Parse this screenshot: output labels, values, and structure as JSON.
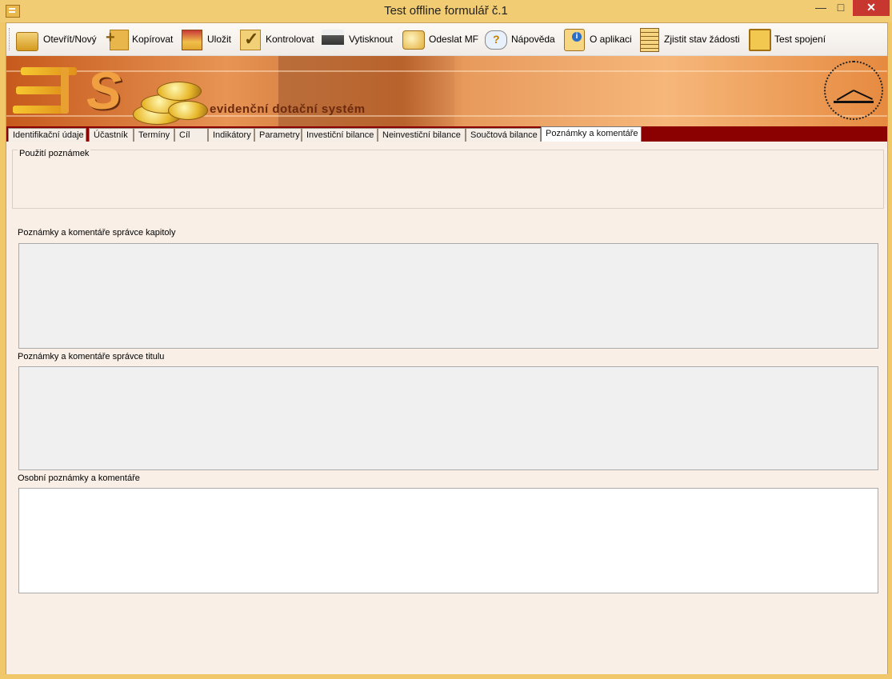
{
  "window": {
    "title": "Test offline formulář č.1",
    "minimize": "—",
    "maximize": "□",
    "close": "✕"
  },
  "toolbar": {
    "items": [
      {
        "label": "Otevřít/Nový",
        "icon": "folder-open-icon"
      },
      {
        "label": "Kopírovat",
        "icon": "copy-add-icon"
      },
      {
        "label": "Uložit",
        "icon": "save-disk-icon"
      },
      {
        "label": "Kontrolovat",
        "icon": "check-icon"
      },
      {
        "label": "Vytisknout",
        "icon": "printer-icon"
      },
      {
        "label": "Odeslat MF",
        "icon": "send-mail-icon"
      },
      {
        "label": "Nápověda",
        "icon": "help-icon"
      },
      {
        "label": "O aplikaci",
        "icon": "info-icon"
      },
      {
        "label": "Zjistit stav žádosti",
        "icon": "status-document-icon"
      },
      {
        "label": "Test spojení",
        "icon": "connection-test-icon"
      }
    ]
  },
  "banner": {
    "tagline": "evidenční dotační systém"
  },
  "tabs": [
    {
      "label": "Identifikační údaje"
    },
    {
      "label": "Účastník"
    },
    {
      "label": "Termíny"
    },
    {
      "label": "Cíl"
    },
    {
      "label": "Indikátory"
    },
    {
      "label": "Parametry"
    },
    {
      "label": "Investiční bilance"
    },
    {
      "label": "Neinvestiční bilance"
    },
    {
      "label": "Součtová bilance"
    },
    {
      "label": "Poznámky a komentáře",
      "active": true
    }
  ],
  "content": {
    "group_title": "Použití poznámek",
    "chapter_label": "Poznámky a komentáře správce kapitoly",
    "chapter_value": "",
    "title_label": "Poznámky a komentáře správce titulu",
    "title_value": "",
    "personal_label": "Osobní poznámky a komentáře",
    "personal_value": ""
  },
  "colors": {
    "title_bar": "#f2cc72",
    "tab_strip": "#8b0000",
    "content_bg": "#f9efe7",
    "readonly_area": "#f0f0f0"
  }
}
